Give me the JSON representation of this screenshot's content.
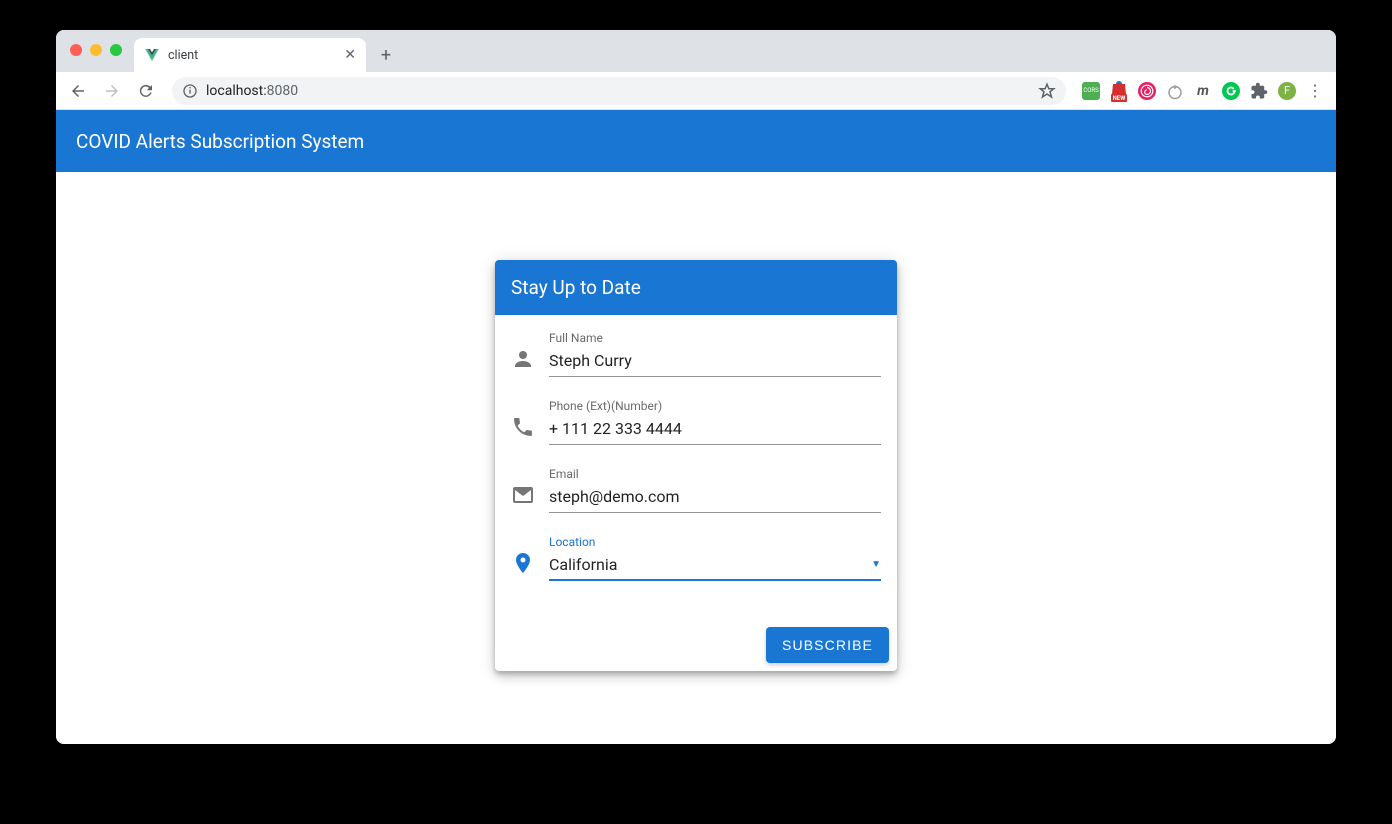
{
  "browser": {
    "tab_title": "client",
    "url_host": "localhost:",
    "url_port": "8080",
    "avatar_initial": "F",
    "extension_cors": "CORS",
    "extension_new_badge": "NEW"
  },
  "app": {
    "header_title": "COVID Alerts Subscription System"
  },
  "card": {
    "title": "Stay Up to Date",
    "fields": {
      "name": {
        "label": "Full Name",
        "value": "Steph Curry"
      },
      "phone": {
        "label": "Phone (Ext)(Number)",
        "value": "+ 111 22 333 4444"
      },
      "email": {
        "label": "Email",
        "value": "steph@demo.com"
      },
      "location": {
        "label": "Location",
        "value": "California"
      }
    },
    "submit_label": "Subscribe"
  }
}
